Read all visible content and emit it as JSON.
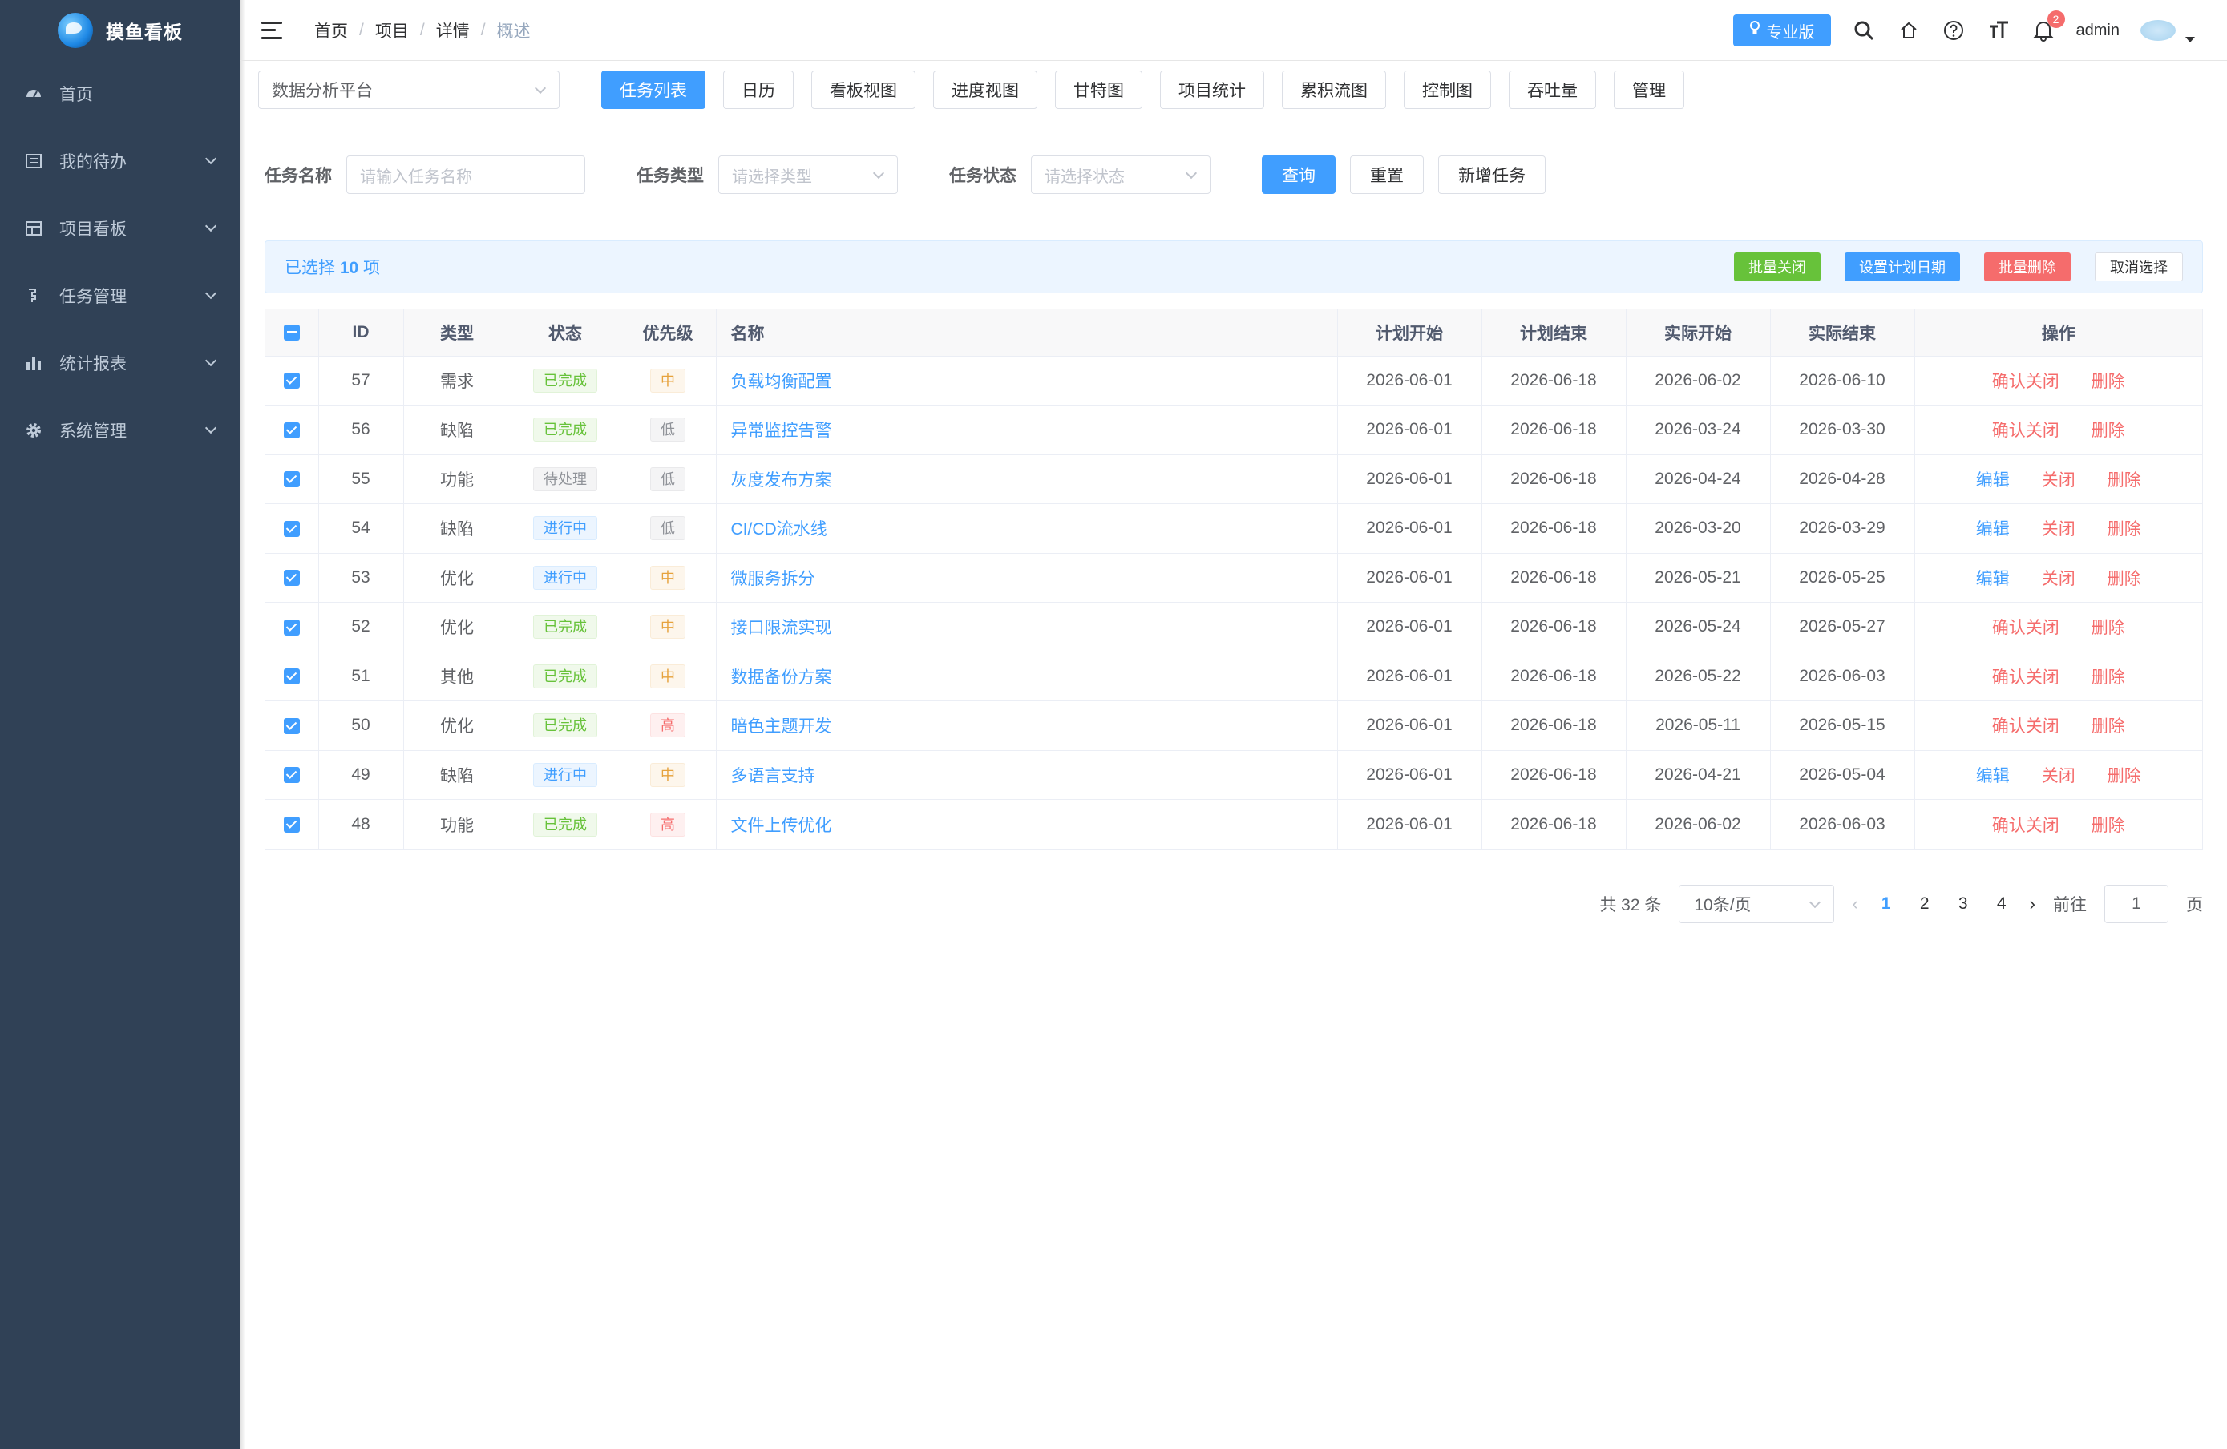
{
  "app": {
    "name": "摸鱼看板"
  },
  "sidebar": {
    "items": [
      {
        "label": "首页",
        "icon": "dashboard-icon"
      },
      {
        "label": "我的待办",
        "icon": "todo-icon"
      },
      {
        "label": "项目看板",
        "icon": "board-icon"
      },
      {
        "label": "任务管理",
        "icon": "task-icon"
      },
      {
        "label": "统计报表",
        "icon": "chart-icon"
      },
      {
        "label": "系统管理",
        "icon": "gear-icon"
      }
    ]
  },
  "header": {
    "breadcrumb": [
      "首页",
      "项目",
      "详情",
      "概述"
    ],
    "pro_label": "专业版",
    "user": "admin",
    "notifications": "2"
  },
  "toolbar": {
    "project": "数据分析平台",
    "tabs": [
      "任务列表",
      "日历",
      "看板视图",
      "进度视图",
      "甘特图",
      "项目统计",
      "累积流图",
      "控制图",
      "吞吐量",
      "管理"
    ]
  },
  "filter": {
    "name_label": "任务名称",
    "name_placeholder": "请输入任务名称",
    "type_label": "任务类型",
    "type_placeholder": "请选择类型",
    "status_label": "任务状态",
    "status_placeholder": "请选择状态",
    "query": "查询",
    "reset": "重置",
    "add": "新增任务"
  },
  "selection": {
    "prefix": "已选择",
    "count": "10",
    "suffix": "项",
    "batch_close": "批量关闭",
    "set_date": "设置计划日期",
    "batch_delete": "批量删除",
    "cancel": "取消选择"
  },
  "table": {
    "columns": [
      "ID",
      "类型",
      "状态",
      "优先级",
      "名称",
      "计划开始",
      "计划结束",
      "实际开始",
      "实际结束",
      "操作"
    ],
    "rows": [
      {
        "id": "57",
        "type": "需求",
        "status": "已完成",
        "status_kind": "done",
        "priority": "中",
        "priority_kind": "mid",
        "name": "负载均衡配置",
        "ps": "2026-06-01",
        "pe": "2026-06-18",
        "as": "2026-06-02",
        "ae": "2026-06-10",
        "ops": [
          [
            "确认关闭",
            "red"
          ],
          [
            "删除",
            "red"
          ]
        ]
      },
      {
        "id": "56",
        "type": "缺陷",
        "status": "已完成",
        "status_kind": "done",
        "priority": "低",
        "priority_kind": "low",
        "name": "异常监控告警",
        "ps": "2026-06-01",
        "pe": "2026-06-18",
        "as": "2026-03-24",
        "ae": "2026-03-30",
        "ops": [
          [
            "确认关闭",
            "red"
          ],
          [
            "删除",
            "red"
          ]
        ]
      },
      {
        "id": "55",
        "type": "功能",
        "status": "待处理",
        "status_kind": "todo",
        "priority": "低",
        "priority_kind": "low",
        "name": "灰度发布方案",
        "ps": "2026-06-01",
        "pe": "2026-06-18",
        "as": "2026-04-24",
        "ae": "2026-04-28",
        "ops": [
          [
            "编辑",
            "blue"
          ],
          [
            "关闭",
            "red"
          ],
          [
            "删除",
            "red"
          ]
        ]
      },
      {
        "id": "54",
        "type": "缺陷",
        "status": "进行中",
        "status_kind": "doing",
        "priority": "低",
        "priority_kind": "low",
        "name": "CI/CD流水线",
        "ps": "2026-06-01",
        "pe": "2026-06-18",
        "as": "2026-03-20",
        "ae": "2026-03-29",
        "ops": [
          [
            "编辑",
            "blue"
          ],
          [
            "关闭",
            "red"
          ],
          [
            "删除",
            "red"
          ]
        ]
      },
      {
        "id": "53",
        "type": "优化",
        "status": "进行中",
        "status_kind": "doing",
        "priority": "中",
        "priority_kind": "mid",
        "name": "微服务拆分",
        "ps": "2026-06-01",
        "pe": "2026-06-18",
        "as": "2026-05-21",
        "ae": "2026-05-25",
        "ops": [
          [
            "编辑",
            "blue"
          ],
          [
            "关闭",
            "red"
          ],
          [
            "删除",
            "red"
          ]
        ]
      },
      {
        "id": "52",
        "type": "优化",
        "status": "已完成",
        "status_kind": "done",
        "priority": "中",
        "priority_kind": "mid",
        "name": "接口限流实现",
        "ps": "2026-06-01",
        "pe": "2026-06-18",
        "as": "2026-05-24",
        "ae": "2026-05-27",
        "ops": [
          [
            "确认关闭",
            "red"
          ],
          [
            "删除",
            "red"
          ]
        ]
      },
      {
        "id": "51",
        "type": "其他",
        "status": "已完成",
        "status_kind": "done",
        "priority": "中",
        "priority_kind": "mid",
        "name": "数据备份方案",
        "ps": "2026-06-01",
        "pe": "2026-06-18",
        "as": "2026-05-22",
        "ae": "2026-06-03",
        "ops": [
          [
            "确认关闭",
            "red"
          ],
          [
            "删除",
            "red"
          ]
        ]
      },
      {
        "id": "50",
        "type": "优化",
        "status": "已完成",
        "status_kind": "done",
        "priority": "高",
        "priority_kind": "high",
        "name": "暗色主题开发",
        "ps": "2026-06-01",
        "pe": "2026-06-18",
        "as": "2026-05-11",
        "ae": "2026-05-15",
        "ops": [
          [
            "确认关闭",
            "red"
          ],
          [
            "删除",
            "red"
          ]
        ]
      },
      {
        "id": "49",
        "type": "缺陷",
        "status": "进行中",
        "status_kind": "doing",
        "priority": "中",
        "priority_kind": "mid",
        "name": "多语言支持",
        "ps": "2026-06-01",
        "pe": "2026-06-18",
        "as": "2026-04-21",
        "ae": "2026-05-04",
        "ops": [
          [
            "编辑",
            "blue"
          ],
          [
            "关闭",
            "red"
          ],
          [
            "删除",
            "red"
          ]
        ]
      },
      {
        "id": "48",
        "type": "功能",
        "status": "已完成",
        "status_kind": "done",
        "priority": "高",
        "priority_kind": "high",
        "name": "文件上传优化",
        "ps": "2026-06-01",
        "pe": "2026-06-18",
        "as": "2026-06-02",
        "ae": "2026-06-03",
        "ops": [
          [
            "确认关闭",
            "red"
          ],
          [
            "删除",
            "red"
          ]
        ]
      }
    ]
  },
  "pagination": {
    "total": "共 32 条",
    "page_size": "10条/页",
    "pages": [
      "1",
      "2",
      "3",
      "4"
    ],
    "current": "1",
    "goto_label": "前往",
    "goto_value": "1",
    "page_suffix": "页"
  },
  "colors": {
    "sidebar": "#304156",
    "primary": "#409eff",
    "success": "#67c23a",
    "danger": "#f56c6c"
  }
}
